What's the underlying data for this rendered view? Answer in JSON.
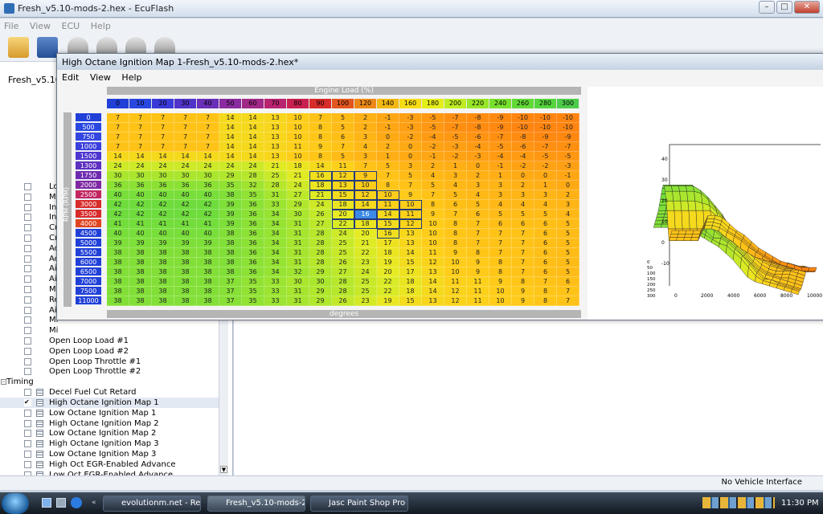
{
  "app_title": "Fresh_v5.10-mods-2.hex - EcuFlash",
  "window_buttons": [
    "–",
    "□",
    "✕"
  ],
  "main_menu": [
    "File",
    "View",
    "ECU",
    "Help"
  ],
  "left_top_label": "Fresh_v5.10-m",
  "child": {
    "title": "High Octane Ignition Map 1-Fresh_v5.10-mods-2.hex*",
    "menu": [
      "Edit",
      "View",
      "Help"
    ],
    "x_axis_title": "Engine Load (%)",
    "y_axis_title": "RPM (RPM)",
    "footer": "degrees"
  },
  "table": {
    "cols": [
      "0",
      "10",
      "20",
      "30",
      "40",
      "50",
      "60",
      "70",
      "80",
      "90",
      "100",
      "120",
      "140",
      "160",
      "180",
      "200",
      "220",
      "240",
      "260",
      "280",
      "300"
    ],
    "col_colors": [
      "#2040d8",
      "#2a48e0",
      "#3a3ad8",
      "#5034c8",
      "#6a2fb8",
      "#8a2aa0",
      "#a22888",
      "#b82470",
      "#c82050",
      "#d82b2b",
      "#e2561f",
      "#ec8818",
      "#f2b814",
      "#f5dc16",
      "#e4ee1a",
      "#bfec22",
      "#98e628",
      "#78e02e",
      "#62da36",
      "#55d43e",
      "#4ccc4a"
    ],
    "rows": [
      "0",
      "500",
      "750",
      "1000",
      "1500",
      "1300",
      "1750",
      "2000",
      "2500",
      "3000",
      "3500",
      "4000",
      "4500",
      "5000",
      "5500",
      "6000",
      "6500",
      "7000",
      "7500",
      "11000"
    ],
    "row_colors": [
      "#2040d8",
      "#2a48e0",
      "#3346e0",
      "#3b3fdc",
      "#4c36cf",
      "#5d30c0",
      "#6e2ab0",
      "#7e28a2",
      "#c22660",
      "#d82b2b",
      "#d82b2b",
      "#e04420",
      "#2040d8",
      "#2040d8",
      "#2040d8",
      "#2040d8",
      "#2040d8",
      "#2040d8",
      "#2040d8",
      "#2040d8"
    ],
    "values": [
      [
        "7",
        "7",
        "7",
        "7",
        "7",
        "14",
        "14",
        "13",
        "10",
        "7",
        "5",
        "2",
        "-1",
        "-3",
        "-5",
        "-7",
        "-8",
        "-9",
        "-10",
        "-10",
        "-10"
      ],
      [
        "7",
        "7",
        "7",
        "7",
        "7",
        "14",
        "14",
        "13",
        "10",
        "8",
        "5",
        "2",
        "-1",
        "-3",
        "-5",
        "-7",
        "-8",
        "-9",
        "-10",
        "-10",
        "-10"
      ],
      [
        "7",
        "7",
        "7",
        "7",
        "7",
        "14",
        "14",
        "13",
        "10",
        "8",
        "6",
        "3",
        "0",
        "-2",
        "-4",
        "-5",
        "-6",
        "-7",
        "-8",
        "-9",
        "-9"
      ],
      [
        "7",
        "7",
        "7",
        "7",
        "7",
        "14",
        "14",
        "13",
        "11",
        "9",
        "7",
        "4",
        "2",
        "0",
        "-2",
        "-3",
        "-4",
        "-5",
        "-6",
        "-7",
        "-7"
      ],
      [
        "14",
        "14",
        "14",
        "14",
        "14",
        "14",
        "14",
        "13",
        "10",
        "8",
        "5",
        "3",
        "1",
        "0",
        "-1",
        "-2",
        "-3",
        "-4",
        "-4",
        "-5",
        "-5"
      ],
      [
        "24",
        "24",
        "24",
        "24",
        "24",
        "24",
        "24",
        "21",
        "18",
        "14",
        "11",
        "7",
        "5",
        "3",
        "2",
        "1",
        "0",
        "-1",
        "-2",
        "-2",
        "-3"
      ],
      [
        "30",
        "30",
        "30",
        "30",
        "30",
        "29",
        "28",
        "25",
        "21",
        "16",
        "12",
        "9",
        "7",
        "5",
        "4",
        "3",
        "2",
        "1",
        "0",
        "0",
        "-1"
      ],
      [
        "36",
        "36",
        "36",
        "36",
        "36",
        "35",
        "32",
        "28",
        "24",
        "18",
        "13",
        "10",
        "8",
        "7",
        "5",
        "4",
        "3",
        "3",
        "2",
        "1",
        "0"
      ],
      [
        "40",
        "40",
        "40",
        "40",
        "40",
        "38",
        "35",
        "31",
        "27",
        "21",
        "15",
        "12",
        "10",
        "9",
        "7",
        "5",
        "4",
        "3",
        "3",
        "3",
        "2"
      ],
      [
        "42",
        "42",
        "42",
        "42",
        "42",
        "39",
        "36",
        "33",
        "29",
        "24",
        "18",
        "14",
        "11",
        "10",
        "8",
        "6",
        "5",
        "4",
        "4",
        "4",
        "3"
      ],
      [
        "42",
        "42",
        "42",
        "42",
        "42",
        "39",
        "36",
        "34",
        "30",
        "26",
        "20",
        "16",
        "14",
        "11",
        "9",
        "7",
        "6",
        "5",
        "5",
        "5",
        "4"
      ],
      [
        "41",
        "41",
        "41",
        "41",
        "41",
        "39",
        "36",
        "34",
        "31",
        "27",
        "22",
        "18",
        "15",
        "12",
        "10",
        "8",
        "7",
        "6",
        "6",
        "6",
        "5"
      ],
      [
        "40",
        "40",
        "40",
        "40",
        "40",
        "38",
        "36",
        "34",
        "31",
        "28",
        "24",
        "20",
        "16",
        "13",
        "10",
        "8",
        "7",
        "7",
        "7",
        "6",
        "5"
      ],
      [
        "39",
        "39",
        "39",
        "39",
        "39",
        "38",
        "36",
        "34",
        "31",
        "28",
        "25",
        "21",
        "17",
        "13",
        "10",
        "8",
        "7",
        "7",
        "7",
        "6",
        "5"
      ],
      [
        "38",
        "38",
        "38",
        "38",
        "38",
        "38",
        "36",
        "34",
        "31",
        "28",
        "25",
        "22",
        "18",
        "14",
        "11",
        "9",
        "8",
        "7",
        "7",
        "6",
        "5"
      ],
      [
        "38",
        "38",
        "38",
        "38",
        "38",
        "38",
        "36",
        "34",
        "31",
        "28",
        "26",
        "23",
        "19",
        "15",
        "12",
        "10",
        "9",
        "8",
        "7",
        "6",
        "5"
      ],
      [
        "38",
        "38",
        "38",
        "38",
        "38",
        "38",
        "36",
        "34",
        "32",
        "29",
        "27",
        "24",
        "20",
        "17",
        "13",
        "10",
        "9",
        "8",
        "7",
        "6",
        "5"
      ],
      [
        "38",
        "38",
        "38",
        "38",
        "38",
        "37",
        "35",
        "33",
        "30",
        "30",
        "28",
        "25",
        "22",
        "18",
        "14",
        "11",
        "11",
        "9",
        "8",
        "7",
        "6"
      ],
      [
        "38",
        "38",
        "38",
        "38",
        "38",
        "37",
        "35",
        "33",
        "31",
        "29",
        "28",
        "25",
        "22",
        "18",
        "14",
        "12",
        "11",
        "10",
        "9",
        "8",
        "7"
      ],
      [
        "38",
        "38",
        "38",
        "38",
        "38",
        "37",
        "35",
        "33",
        "31",
        "29",
        "26",
        "23",
        "19",
        "15",
        "13",
        "12",
        "11",
        "10",
        "9",
        "8",
        "7"
      ]
    ],
    "cursor": [
      10,
      11
    ]
  },
  "plot": {
    "y_ticks": [
      "40",
      "30",
      "20",
      "10",
      "0",
      "-10"
    ],
    "x_ticks": [
      "0",
      "2000",
      "4000",
      "6000",
      "8000",
      "10000"
    ],
    "z_ticks": [
      "0",
      "50",
      "100",
      "150",
      "200",
      "250",
      "300"
    ]
  },
  "tree": {
    "partial_rows": [
      "Lo",
      "Mi",
      "In",
      "In",
      "Cr",
      "Cr",
      "Ac",
      "Ac",
      "Ai",
      "Ai",
      "Mi",
      "Re",
      "Ai",
      "Mi",
      "Mi"
    ],
    "rows_full": [
      {
        "label": "Open Loop Load #1"
      },
      {
        "label": "Open Loop Load #2"
      },
      {
        "label": "Open Loop Throttle #1"
      },
      {
        "label": "Open Loop Throttle #2"
      }
    ],
    "category": "Timing",
    "timing_rows": [
      {
        "label": "Decel Fuel Cut Retard",
        "checked": false
      },
      {
        "label": "High Octane Ignition Map 1",
        "checked": true
      },
      {
        "label": "Low Octane Ignition Map 1",
        "checked": false
      },
      {
        "label": "High Octane Ignition Map 2",
        "checked": false
      },
      {
        "label": "Low Octane Ignition Map 2",
        "checked": false
      },
      {
        "label": "High Octane Ignition Map 3",
        "checked": false
      },
      {
        "label": "Low Octane Ignition Map 3",
        "checked": false
      },
      {
        "label": "High Oct EGR-Enabled Advance",
        "checked": false
      },
      {
        "label": "Low Oct EGR-Enabled Advance",
        "checked": false
      }
    ]
  },
  "status_text": "No Vehicle Interface",
  "taskbar": {
    "items": [
      "evolutionm.net - Re...",
      "Fresh_v5.10-mods-2....",
      "Jasc Paint Shop Pro"
    ],
    "clock": "11:30 PM"
  }
}
